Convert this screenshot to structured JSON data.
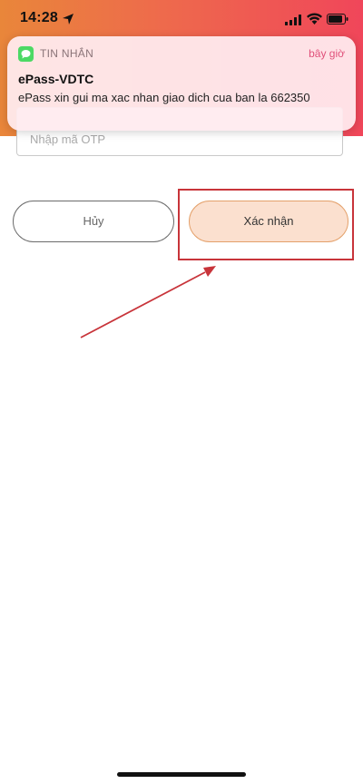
{
  "status_bar": {
    "time": "14:28",
    "icons": [
      "location-icon",
      "signal-icon",
      "wifi-icon",
      "battery-icon"
    ]
  },
  "notification": {
    "app_name": "TIN NHẮN",
    "time": "bây giờ",
    "title": "ePass-VDTC",
    "body": "ePass xin gui ma xac nhan giao dich cua ban la 662350",
    "icon": "message-icon"
  },
  "otp_field": {
    "placeholder": "Nhập mã OTP"
  },
  "buttons": {
    "cancel_label": "Hủy",
    "confirm_label": "Xác nhận"
  },
  "colors": {
    "header_gradient_start": "#e9863a",
    "header_gradient_end": "#f0465a",
    "confirm_fill": "#fbe0cf",
    "confirm_border": "#e4a06a",
    "annotation_red": "#c8343a"
  }
}
